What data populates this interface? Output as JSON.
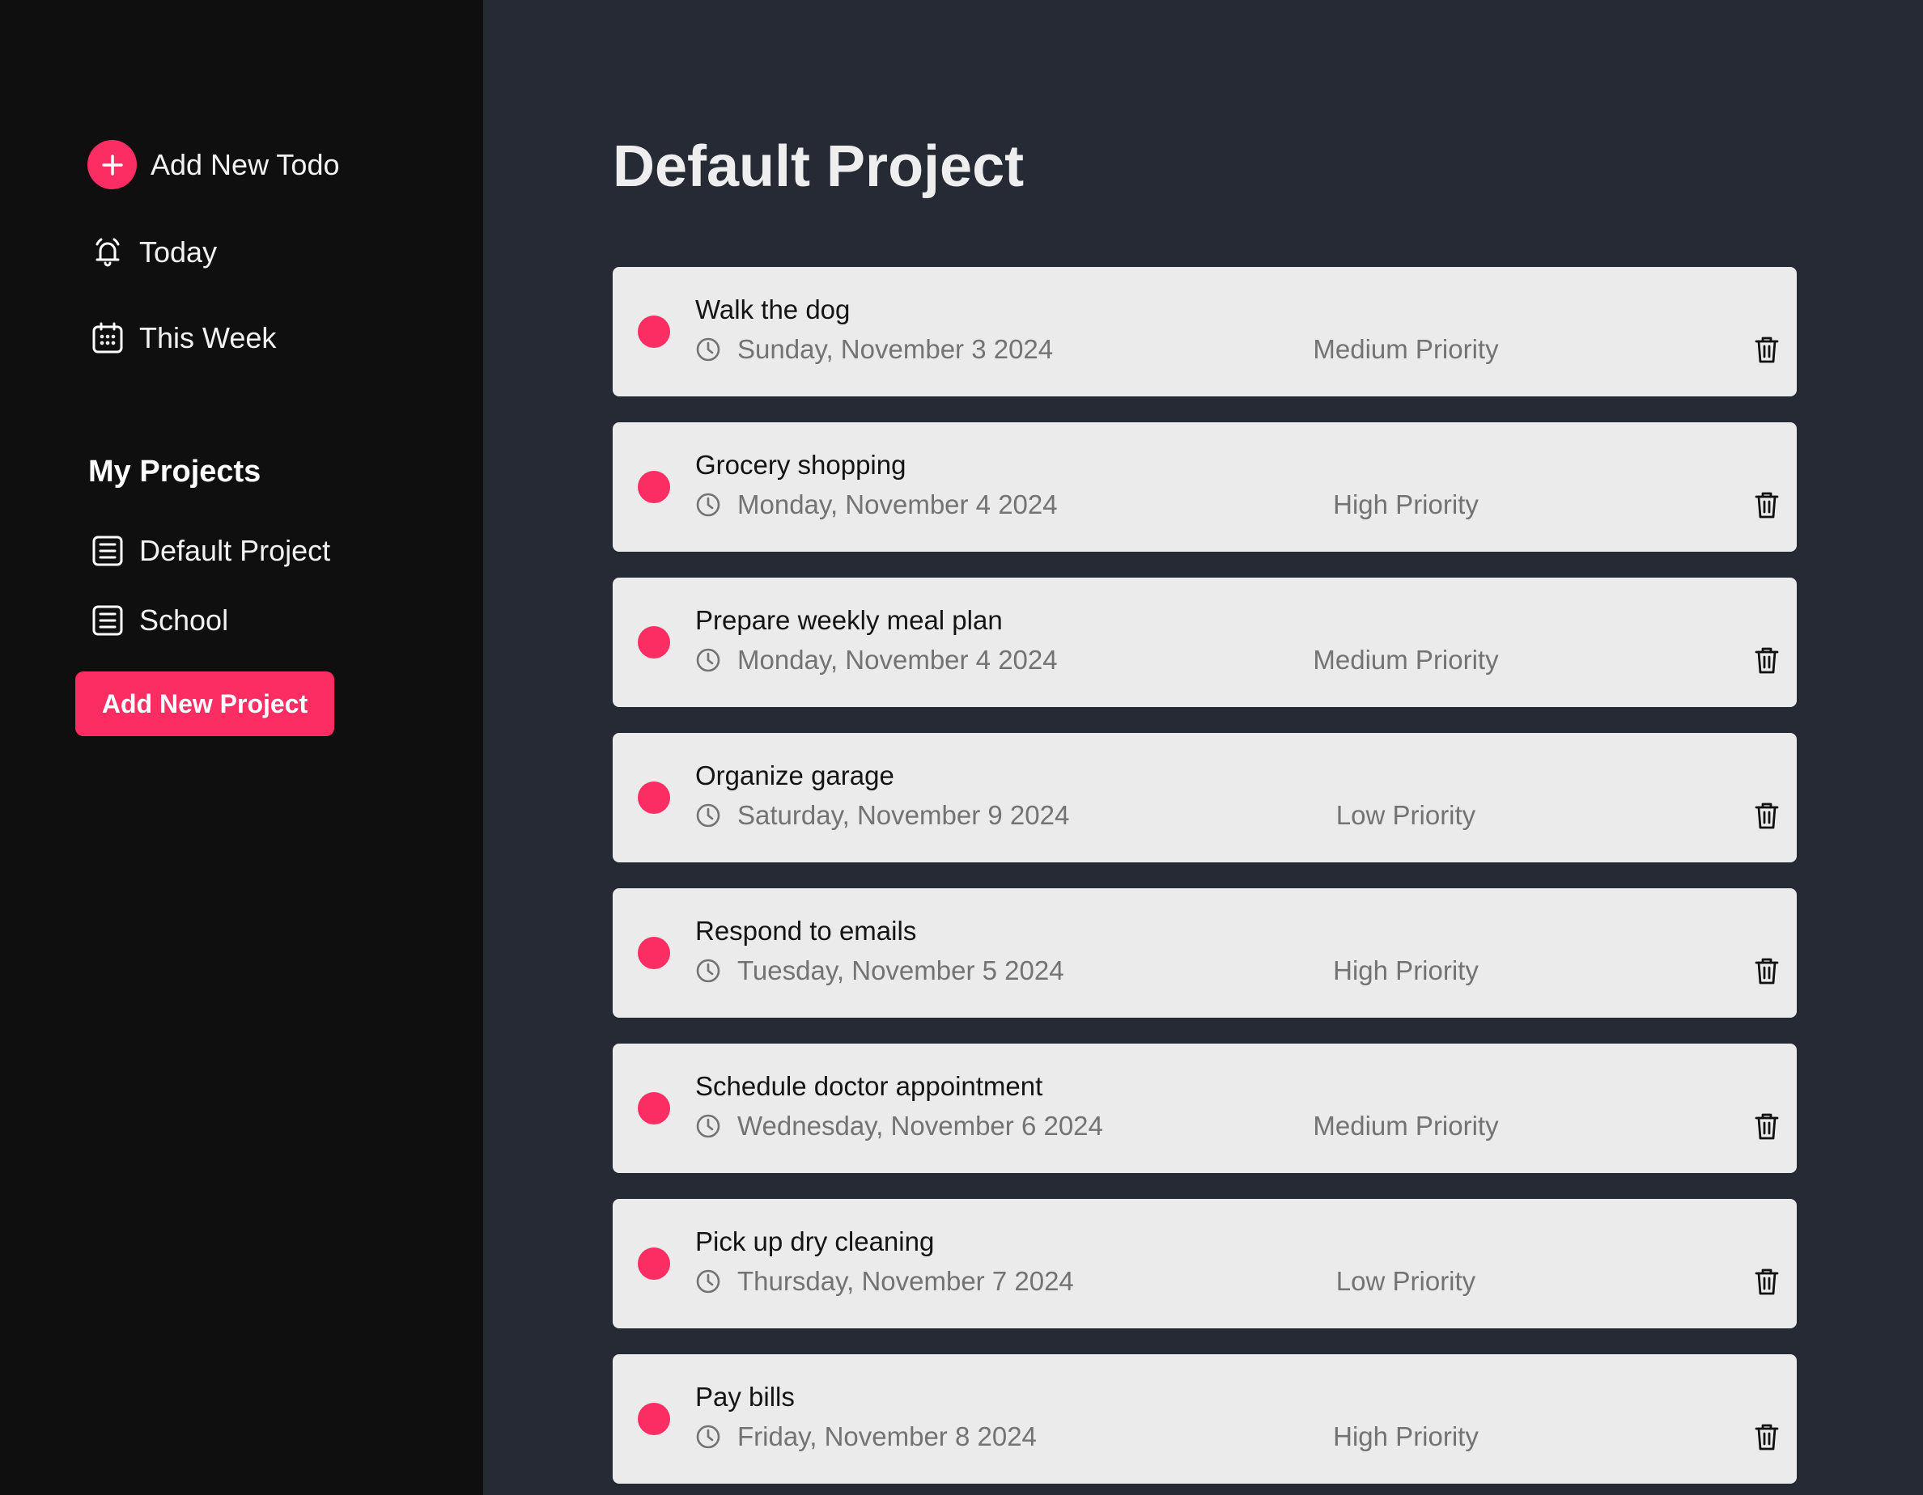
{
  "sidebar": {
    "add_todo_label": "Add New Todo",
    "today_label": "Today",
    "week_label": "This Week",
    "projects_heading": "My Projects",
    "projects": [
      {
        "label": "Default Project"
      },
      {
        "label": "School"
      }
    ],
    "add_project_label": "Add New Project"
  },
  "main": {
    "title": "Default Project",
    "todos": [
      {
        "title": "Walk the dog",
        "date": "Sunday, November 3 2024",
        "priority": "Medium Priority"
      },
      {
        "title": "Grocery shopping",
        "date": "Monday, November 4 2024",
        "priority": "High Priority"
      },
      {
        "title": "Prepare weekly meal plan",
        "date": "Monday, November 4 2024",
        "priority": "Medium Priority"
      },
      {
        "title": "Organize garage",
        "date": "Saturday, November 9 2024",
        "priority": "Low Priority"
      },
      {
        "title": "Respond to emails",
        "date": "Tuesday, November 5 2024",
        "priority": "High Priority"
      },
      {
        "title": "Schedule doctor appointment",
        "date": "Wednesday, November 6 2024",
        "priority": "Medium Priority"
      },
      {
        "title": "Pick up dry cleaning",
        "date": "Thursday, November 7 2024",
        "priority": "Low Priority"
      },
      {
        "title": "Pay bills",
        "date": "Friday, November 8 2024",
        "priority": "High Priority"
      }
    ]
  },
  "icons": {
    "add": "plus-circle-icon",
    "today": "bell-icon",
    "week": "calendar-icon",
    "project": "list-icon",
    "date": "clock-icon",
    "delete": "trash-icon"
  },
  "colors": {
    "accent": "#fc2d63",
    "sidebar_bg": "#0f0f10",
    "main_bg": "#262a35",
    "card_bg": "#ebebeb"
  }
}
